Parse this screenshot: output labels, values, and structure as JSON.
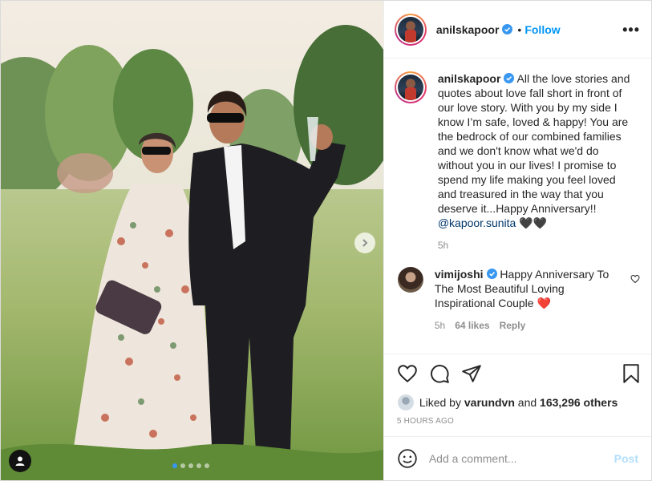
{
  "header": {
    "username": "anilskapoor",
    "separator": "•",
    "follow_label": "Follow",
    "more_label": "•••"
  },
  "caption": {
    "username": "anilskapoor",
    "text": " All the love stories and quotes about love fall short in front of our love story. With you by my side I know I’m safe, loved & happy! You are the bedrock of our combined families and we don't know what we'd do without you in our lives! I promise to spend my life making you feel loved and treasured in the way that you deserve it...Happy Anniversary!! ",
    "mention": "@kapoor.sunita",
    "emoji": " 🖤🖤",
    "time": "5h"
  },
  "comment": {
    "username": "vimijoshi",
    "text": " Happy Anniversary To The Most Beautiful Loving Inspirational Couple ❤️",
    "time": "5h",
    "likes": "64 likes",
    "reply": "Reply"
  },
  "likes": {
    "prefix": "Liked by ",
    "user": "varundvn",
    "middle": " and ",
    "count": "163,296 others"
  },
  "timestamp": "5 HOURS AGO",
  "add_comment": {
    "placeholder": "Add a comment...",
    "post_label": "Post"
  },
  "carousel": {
    "slides": 5,
    "active": 1
  },
  "colors": {
    "link": "#0095f6",
    "post_disabled": "#b2dffc",
    "heart": "#ed4956"
  }
}
